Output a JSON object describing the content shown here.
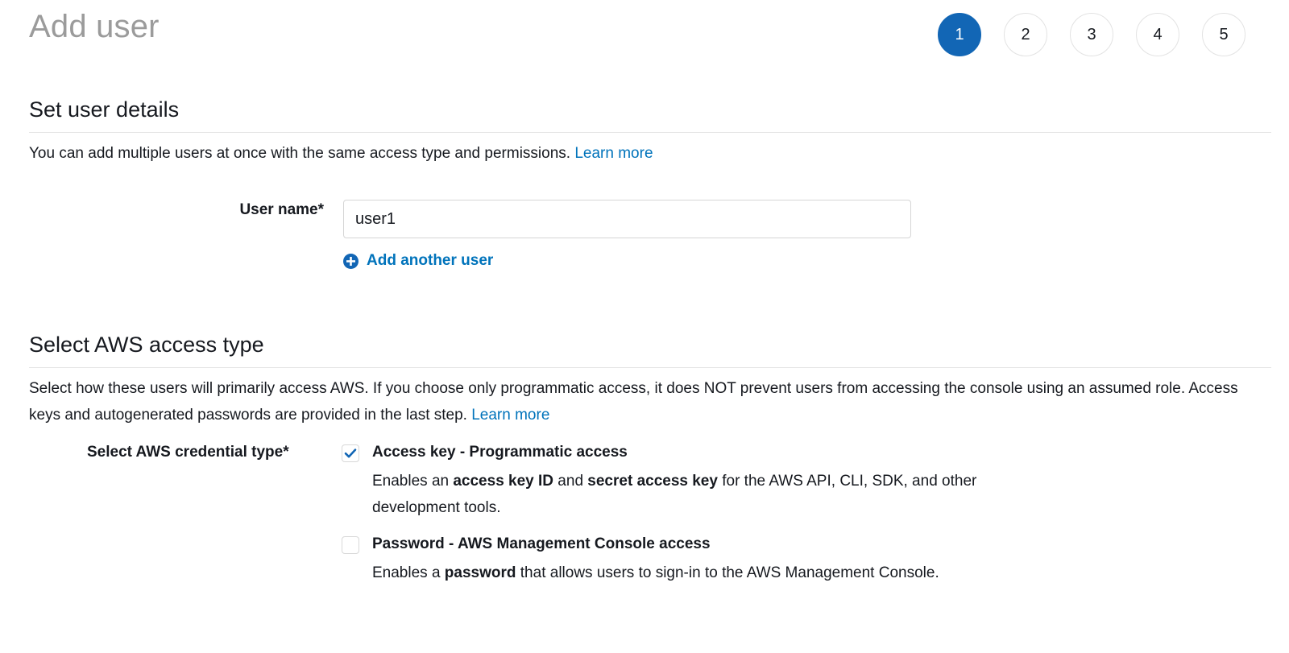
{
  "header": {
    "title": "Add user",
    "steps": [
      {
        "number": "1",
        "active": true
      },
      {
        "number": "2",
        "active": false
      },
      {
        "number": "3",
        "active": false
      },
      {
        "number": "4",
        "active": false
      },
      {
        "number": "5",
        "active": false
      }
    ]
  },
  "user_details": {
    "section_title": "Set user details",
    "description": "You can add multiple users at once with the same access type and permissions.",
    "learn_more": "Learn more",
    "user_name_label": "User name*",
    "user_name_value": "user1",
    "user_name_placeholder": "",
    "add_another_label": "Add another user",
    "add_another_icon": "plus-circle-icon"
  },
  "access_type": {
    "section_title": "Select AWS access type",
    "description": "Select how these users will primarily access AWS. If you choose only programmatic access, it does NOT prevent users from accessing the console using an assumed role. Access keys and autogenerated passwords are provided in the last step.",
    "learn_more": "Learn more",
    "credential_label": "Select AWS credential type*",
    "options": [
      {
        "checked": true,
        "title": "Access key - Programmatic access",
        "desc_parts": [
          {
            "text": "Enables an ",
            "bold": false
          },
          {
            "text": "access key ID",
            "bold": true
          },
          {
            "text": " and ",
            "bold": false
          },
          {
            "text": "secret access key",
            "bold": true
          },
          {
            "text": " for the AWS API, CLI, SDK, and other development tools.",
            "bold": false
          }
        ]
      },
      {
        "checked": false,
        "title": "Password - AWS Management Console access",
        "desc_parts": [
          {
            "text": "Enables a ",
            "bold": false
          },
          {
            "text": "password",
            "bold": true
          },
          {
            "text": " that allows users to sign-in to the AWS Management Console.",
            "bold": false
          }
        ]
      }
    ]
  },
  "colors": {
    "accent_blue": "#1266b5",
    "link_blue": "#0073bb",
    "title_gray": "#9b9b9b",
    "text": "#16191f",
    "divider": "#e6e6e6"
  }
}
